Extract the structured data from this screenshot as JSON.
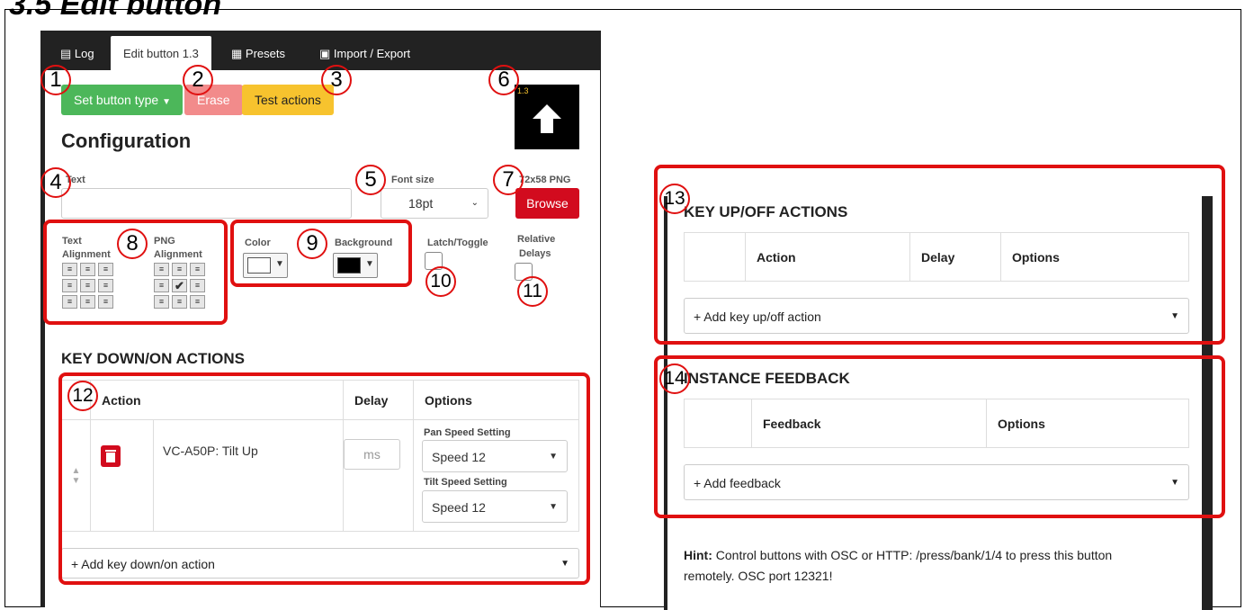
{
  "heading": "3.5    Edit button",
  "tabs": {
    "log": "Log",
    "edit": "Edit button 1.3",
    "presets": "Presets",
    "import_export": "Import / Export"
  },
  "toolbar": {
    "set_type": "Set button type",
    "erase": "Erase",
    "test": "Test actions"
  },
  "preview": {
    "label": "1.3"
  },
  "config": {
    "title": "Configuration",
    "text_label": "Text",
    "text_value": "",
    "font_size_label": "Font size",
    "font_size_value": "18pt",
    "png_label": "72x58 PNG",
    "browse": "Browse",
    "text_alignment_label_1": "Text",
    "text_alignment_label_2": "Alignment",
    "png_alignment_label_1": "PNG",
    "png_alignment_label_2": "Alignment",
    "color_label": "Color",
    "background_label": "Background",
    "latch_label": "Latch/Toggle",
    "relative_delays_label_1": "Relative",
    "relative_delays_label_2": "Delays"
  },
  "colors": {
    "text_color": "#ffffff",
    "background_color": "#000000",
    "annotation": "#e01010"
  },
  "key_down": {
    "title": "KEY DOWN/ON ACTIONS",
    "headers": {
      "action": "Action",
      "delay": "Delay",
      "options": "Options"
    },
    "row": {
      "action": "VC-A50P: Tilt Up",
      "delay_placeholder": "ms",
      "pan_label": "Pan Speed Setting",
      "pan_value": "Speed 12",
      "tilt_label": "Tilt Speed Setting",
      "tilt_value": "Speed 12"
    },
    "add": "+ Add key down/on action"
  },
  "key_up": {
    "title": "KEY UP/OFF ACTIONS",
    "headers": {
      "action": "Action",
      "delay": "Delay",
      "options": "Options"
    },
    "add": "+ Add key up/off action"
  },
  "feedback": {
    "title": "INSTANCE FEEDBACK",
    "headers": {
      "feedback": "Feedback",
      "options": "Options"
    },
    "add": "+ Add feedback"
  },
  "hint": {
    "bold": "Hint:",
    "text": " Control buttons with OSC or HTTP: /press/bank/1/4 to press this button",
    "text2": "remotely. OSC port 12321!"
  },
  "callouts": [
    "1",
    "2",
    "3",
    "4",
    "5",
    "6",
    "7",
    "8",
    "9",
    "10",
    "11",
    "12",
    "13",
    "14"
  ]
}
